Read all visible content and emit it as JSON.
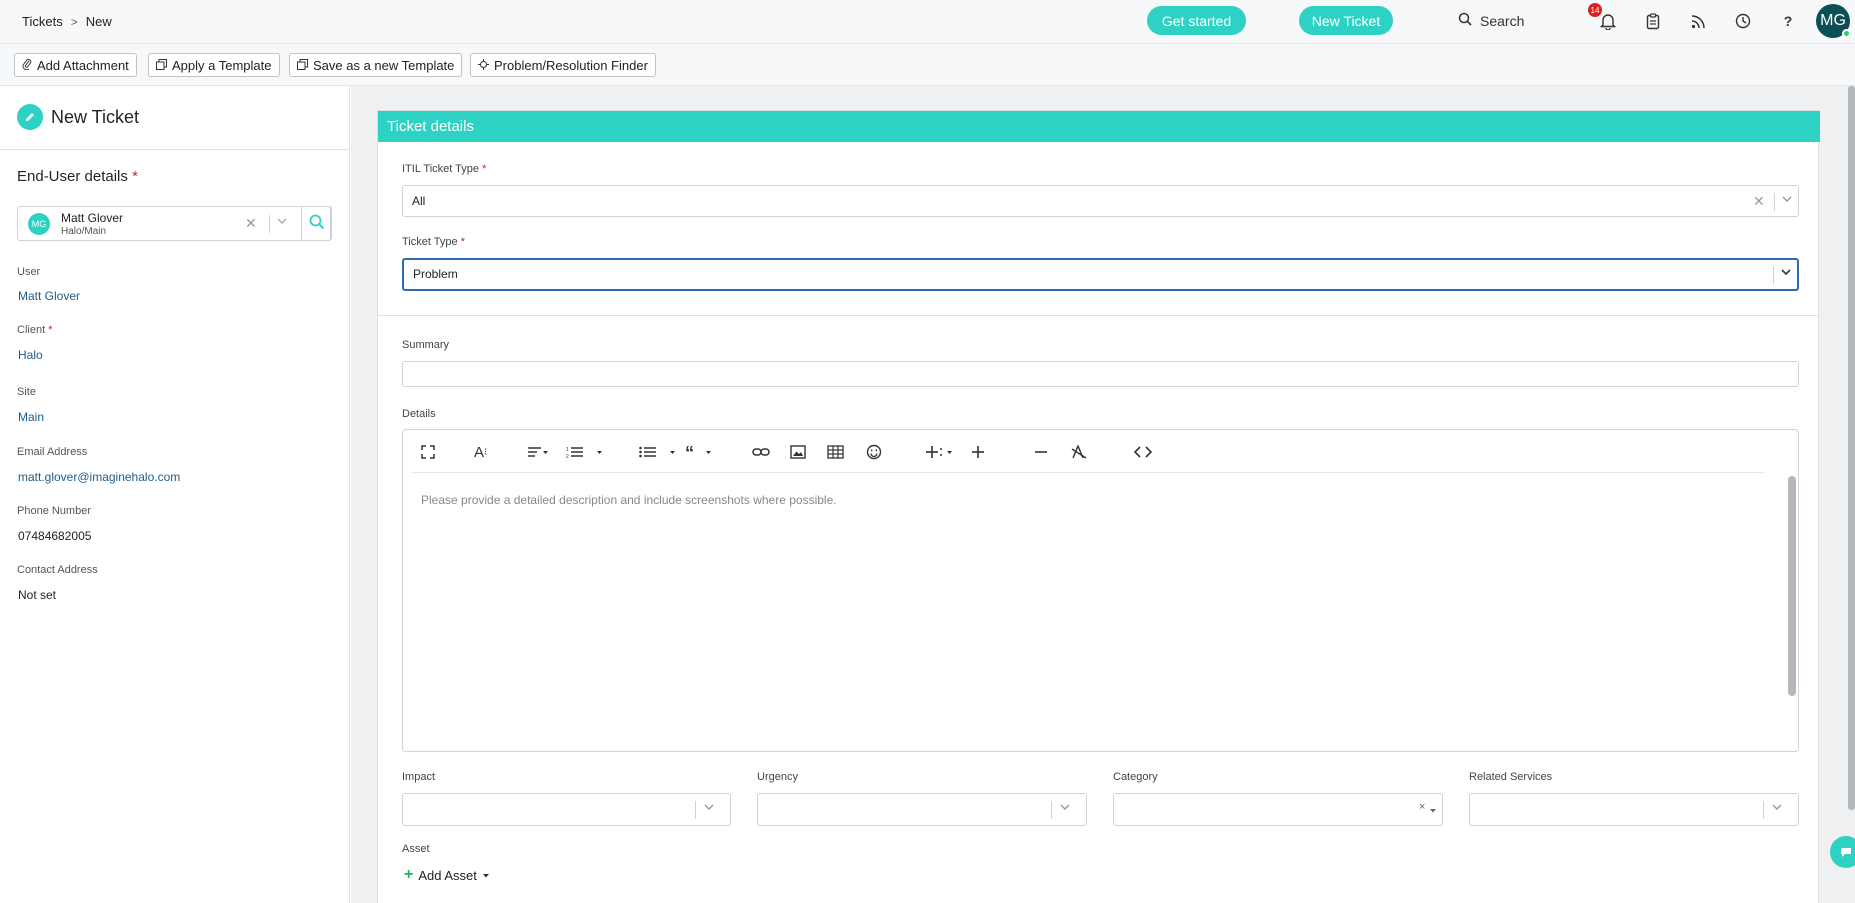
{
  "breadcrumb": {
    "root": "Tickets",
    "separator": ">",
    "current": "New"
  },
  "header": {
    "get_started": "Get started",
    "new_ticket": "New Ticket",
    "search_label": "Search",
    "notification_count": "14",
    "avatar_initials": "MG"
  },
  "toolbar": {
    "add_attachment": "Add Attachment",
    "apply_template": "Apply a Template",
    "save_template": "Save as a new Template",
    "finder": "Problem/Resolution Finder"
  },
  "sidebar": {
    "title": "New Ticket",
    "end_user_title": "End-User details",
    "required_mark": "*",
    "selected_user": {
      "initials": "MG",
      "name": "Matt Glover",
      "sub": "Halo/Main"
    },
    "fields": [
      {
        "label": "User",
        "value": "Matt Glover"
      },
      {
        "label": "Client",
        "value": "Halo"
      },
      {
        "label": "Site",
        "value": "Main"
      },
      {
        "label": "Email Address",
        "value": "matt.glover@imaginehalo.com"
      },
      {
        "label": "Phone Number",
        "value": "07484682005"
      },
      {
        "label": "Contact Address",
        "value": "Not set"
      }
    ]
  },
  "details_card": {
    "title": "Ticket details",
    "itil_label": "ITIL Ticket Type",
    "itil_value": "All",
    "ticket_type_label": "Ticket Type",
    "ticket_type_value": "Problem",
    "summary_label": "Summary",
    "summary_value": "",
    "details_label": "Details",
    "details_placeholder": "Please provide a detailed description and include screenshots where possible.",
    "impact_label": "Impact",
    "urgency_label": "Urgency",
    "category_label": "Category",
    "related_services_label": "Related Services",
    "asset_label": "Asset",
    "add_asset": "Add Asset"
  },
  "colors": {
    "accent": "#2ed2c4",
    "link": "#1f5c8a",
    "required": "#e02020",
    "focus": "#2b6cb0"
  }
}
